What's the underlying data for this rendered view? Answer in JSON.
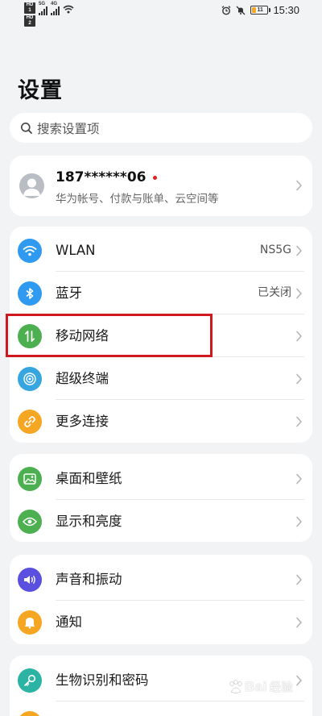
{
  "status_bar": {
    "sim1_chip": "HD 1",
    "sim2_chip": "HD 2",
    "sim1_network": "5G",
    "sim2_network": "4G",
    "battery_level": "11",
    "time": "15:30",
    "icons": [
      "alarm-icon",
      "mute-icon",
      "battery-icon",
      "wifi-icon",
      "signal-icon"
    ]
  },
  "page": {
    "title": "设置"
  },
  "search": {
    "placeholder": "搜索设置项"
  },
  "account": {
    "name": "187******06",
    "subtitle": "华为帐号、付款与账单、云空间等"
  },
  "groups": [
    {
      "items": [
        {
          "label": "WLAN",
          "value": "NS5G",
          "icon": "wifi-icon",
          "color": "#2f9af0"
        },
        {
          "label": "蓝牙",
          "value": "已关闭",
          "icon": "bluetooth-icon",
          "color": "#2f9af0"
        },
        {
          "label": "移动网络",
          "value": "",
          "icon": "mobile-data-icon",
          "color": "#4caf50"
        },
        {
          "label": "超级终端",
          "value": "",
          "icon": "super-device-icon",
          "color": "#37a6e0"
        },
        {
          "label": "更多连接",
          "value": "",
          "icon": "link-icon",
          "color": "#f5a623"
        }
      ]
    },
    {
      "items": [
        {
          "label": "桌面和壁纸",
          "icon": "wallpaper-icon",
          "color": "#4caf50"
        },
        {
          "label": "显示和亮度",
          "icon": "eye-icon",
          "color": "#4caf50"
        }
      ]
    },
    {
      "items": [
        {
          "label": "声音和振动",
          "icon": "sound-icon",
          "color": "#5b4fe0"
        },
        {
          "label": "通知",
          "icon": "bell-icon",
          "color": "#f5a623"
        }
      ]
    },
    {
      "items": [
        {
          "label": "生物识别和密码",
          "icon": "key-icon",
          "color": "#2bb3a3"
        }
      ]
    }
  ],
  "watermark": {
    "brand": "Bai",
    "brand_suffix": "经验"
  },
  "colors": {
    "background": "#f1f3f5",
    "card": "#ffffff",
    "highlight": "#d0181f",
    "notice_dot": "#e02020"
  }
}
